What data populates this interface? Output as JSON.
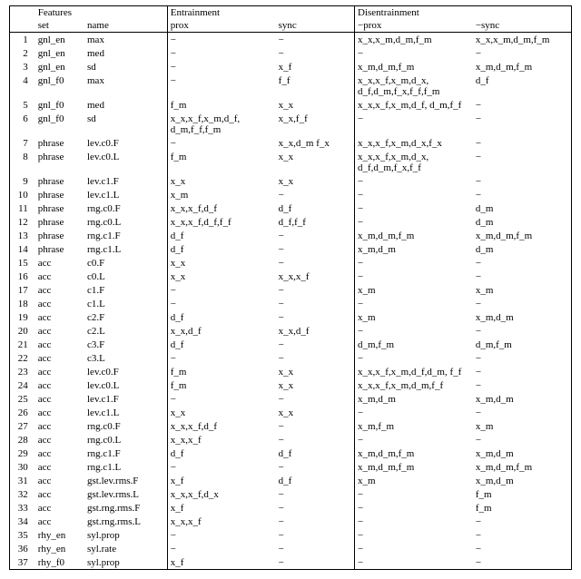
{
  "header": {
    "features": "Features",
    "set": "set",
    "name": "name",
    "entrainment": "Entrainment",
    "prox": "prox",
    "sync": "sync",
    "disentrainment": "Disentrainment",
    "mprox": "−prox",
    "msync": "−sync"
  },
  "rows": [
    {
      "n": "1",
      "set": "gnl_en",
      "name": "max",
      "prox": "−",
      "sync": "−",
      "mprox": "x_x,x_m,d_m,f_m",
      "msync": "x_x,x_m,d_m,f_m"
    },
    {
      "n": "2",
      "set": "gnl_en",
      "name": "med",
      "prox": "−",
      "sync": "−",
      "mprox": "−",
      "msync": "−"
    },
    {
      "n": "3",
      "set": "gnl_en",
      "name": "sd",
      "prox": "−",
      "sync": "x_f",
      "mprox": "x_m,d_m,f_m",
      "msync": "x_m,d_m,f_m"
    },
    {
      "n": "4",
      "set": "gnl_f0",
      "name": "max",
      "prox": "−",
      "sync": "f_f",
      "mprox": "x_x,x_f,x_m,d_x, d_f,d_m,f_x,f_f,f_m",
      "msync": "d_f"
    },
    {
      "n": "5",
      "set": "gnl_f0",
      "name": "med",
      "prox": "f_m",
      "sync": "x_x",
      "mprox": "x_x,x_f,x_m,d_f, d_m,f_f",
      "msync": "−"
    },
    {
      "n": "6",
      "set": "gnl_f0",
      "name": "sd",
      "prox": "x_x,x_f,x_m,d_f, d_m,f_f,f_m",
      "sync": "x_x,f_f",
      "mprox": "−",
      "msync": "−"
    },
    {
      "n": "7",
      "set": "phrase",
      "name": "lev.c0.F",
      "prox": "−",
      "sync": "x_x,d_m f_x",
      "mprox": "x_x,x_f,x_m,d_x,f_x",
      "msync": "−"
    },
    {
      "n": "8",
      "set": "phrase",
      "name": "lev.c0.L",
      "prox": "f_m",
      "sync": "x_x",
      "mprox": "x_x,x_f,x_m,d_x, d_f,d_m,f_x,f_f",
      "msync": "−"
    },
    {
      "n": "9",
      "set": "phrase",
      "name": "lev.c1.F",
      "prox": "x_x",
      "sync": "x_x",
      "mprox": "−",
      "msync": "−"
    },
    {
      "n": "10",
      "set": "phrase",
      "name": "lev.c1.L",
      "prox": "x_m",
      "sync": "−",
      "mprox": "−",
      "msync": "−"
    },
    {
      "n": "11",
      "set": "phrase",
      "name": "rng.c0.F",
      "prox": "x_x,x_f,d_f",
      "sync": "d_f",
      "mprox": "−",
      "msync": "d_m"
    },
    {
      "n": "12",
      "set": "phrase",
      "name": "rng.c0.L",
      "prox": "x_x,x_f,d_f,f_f",
      "sync": "d_f,f_f",
      "mprox": "−",
      "msync": "d_m"
    },
    {
      "n": "13",
      "set": "phrase",
      "name": "rng.c1.F",
      "prox": "d_f",
      "sync": "−",
      "mprox": "x_m,d_m,f_m",
      "msync": "x_m,d_m,f_m"
    },
    {
      "n": "14",
      "set": "phrase",
      "name": "rng.c1.L",
      "prox": "d_f",
      "sync": "−",
      "mprox": "x_m,d_m",
      "msync": "d_m"
    },
    {
      "n": "15",
      "set": "acc",
      "name": "c0.F",
      "prox": "x_x",
      "sync": "−",
      "mprox": "−",
      "msync": "−"
    },
    {
      "n": "16",
      "set": "acc",
      "name": "c0.L",
      "prox": "x_x",
      "sync": "x_x,x_f",
      "mprox": "−",
      "msync": "−"
    },
    {
      "n": "17",
      "set": "acc",
      "name": "c1.F",
      "prox": "−",
      "sync": "−",
      "mprox": "x_m",
      "msync": "x_m"
    },
    {
      "n": "18",
      "set": "acc",
      "name": "c1.L",
      "prox": "−",
      "sync": "−",
      "mprox": "−",
      "msync": "−"
    },
    {
      "n": "19",
      "set": "acc",
      "name": "c2.F",
      "prox": "d_f",
      "sync": "−",
      "mprox": "x_m",
      "msync": "x_m,d_m"
    },
    {
      "n": "20",
      "set": "acc",
      "name": "c2.L",
      "prox": "x_x,d_f",
      "sync": "x_x,d_f",
      "mprox": "−",
      "msync": "−"
    },
    {
      "n": "21",
      "set": "acc",
      "name": "c3.F",
      "prox": "d_f",
      "sync": "−",
      "mprox": "d_m,f_m",
      "msync": "d_m,f_m"
    },
    {
      "n": "22",
      "set": "acc",
      "name": "c3.L",
      "prox": "−",
      "sync": "−",
      "mprox": "−",
      "msync": "−"
    },
    {
      "n": "23",
      "set": "acc",
      "name": "lev.c0.F",
      "prox": "f_m",
      "sync": "x_x",
      "mprox": "x_x,x_f,x_m,d_f,d_m, f_f",
      "msync": "−"
    },
    {
      "n": "24",
      "set": "acc",
      "name": "lev.c0.L",
      "prox": "f_m",
      "sync": "x_x",
      "mprox": "x_x,x_f,x_m,d_m,f_f",
      "msync": "−"
    },
    {
      "n": "25",
      "set": "acc",
      "name": "lev.c1.F",
      "prox": "−",
      "sync": "−",
      "mprox": "x_m,d_m",
      "msync": "x_m,d_m"
    },
    {
      "n": "26",
      "set": "acc",
      "name": "lev.c1.L",
      "prox": "x_x",
      "sync": "x_x",
      "mprox": "−",
      "msync": "−"
    },
    {
      "n": "27",
      "set": "acc",
      "name": "rng.c0.F",
      "prox": "x_x,x_f,d_f",
      "sync": "−",
      "mprox": "x_m,f_m",
      "msync": "x_m"
    },
    {
      "n": "28",
      "set": "acc",
      "name": "rng.c0.L",
      "prox": "x_x,x_f",
      "sync": "−",
      "mprox": "−",
      "msync": "−"
    },
    {
      "n": "29",
      "set": "acc",
      "name": "rng.c1.F",
      "prox": "d_f",
      "sync": "d_f",
      "mprox": "x_m,d_m,f_m",
      "msync": "x_m,d_m"
    },
    {
      "n": "30",
      "set": "acc",
      "name": "rng.c1.L",
      "prox": "−",
      "sync": "−",
      "mprox": "x_m,d_m,f_m",
      "msync": "x_m,d_m,f_m"
    },
    {
      "n": "31",
      "set": "acc",
      "name": "gst.lev.rms.F",
      "prox": "x_f",
      "sync": "d_f",
      "mprox": "x_m",
      "msync": "x_m,d_m"
    },
    {
      "n": "32",
      "set": "acc",
      "name": "gst.lev.rms.L",
      "prox": "x_x,x_f,d_x",
      "sync": "−",
      "mprox": "−",
      "msync": "f_m"
    },
    {
      "n": "33",
      "set": "acc",
      "name": "gst.rng.rms.F",
      "prox": "x_f",
      "sync": "−",
      "mprox": "−",
      "msync": "f_m"
    },
    {
      "n": "34",
      "set": "acc",
      "name": "gst.rng.rms.L",
      "prox": "x_x,x_f",
      "sync": "−",
      "mprox": "−",
      "msync": "−"
    },
    {
      "n": "35",
      "set": "rhy_en",
      "name": "syl.prop",
      "prox": "−",
      "sync": "−",
      "mprox": "−",
      "msync": "−"
    },
    {
      "n": "36",
      "set": "rhy_en",
      "name": "syl.rate",
      "prox": "−",
      "sync": "−",
      "mprox": "−",
      "msync": "−"
    },
    {
      "n": "37",
      "set": "rhy_f0",
      "name": "syl.prop",
      "prox": "x_f",
      "sync": "−",
      "mprox": "−",
      "msync": "−"
    }
  ]
}
